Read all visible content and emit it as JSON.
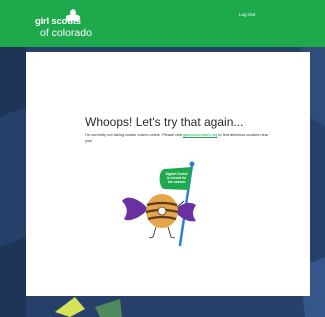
{
  "header": {
    "logo_line1": "girl scouts",
    "logo_line2": "of colorado",
    "logout_label": "Log Out"
  },
  "main": {
    "title": "Whoops! Let's try that again...",
    "message_before_link": "I'm currently not taking cookie orders online. Please visit ",
    "link_text": "girlscoutcookies.org",
    "message_after_link": " to find delicious cookies near you!",
    "flag_text": "Digital Cookie is closed for the season."
  },
  "colors": {
    "brand_green": "#1da94c",
    "background_navy": "#27406a",
    "flag_pole_blue": "#2a7fd4",
    "wrapper_purple": "#6a2fa0"
  }
}
